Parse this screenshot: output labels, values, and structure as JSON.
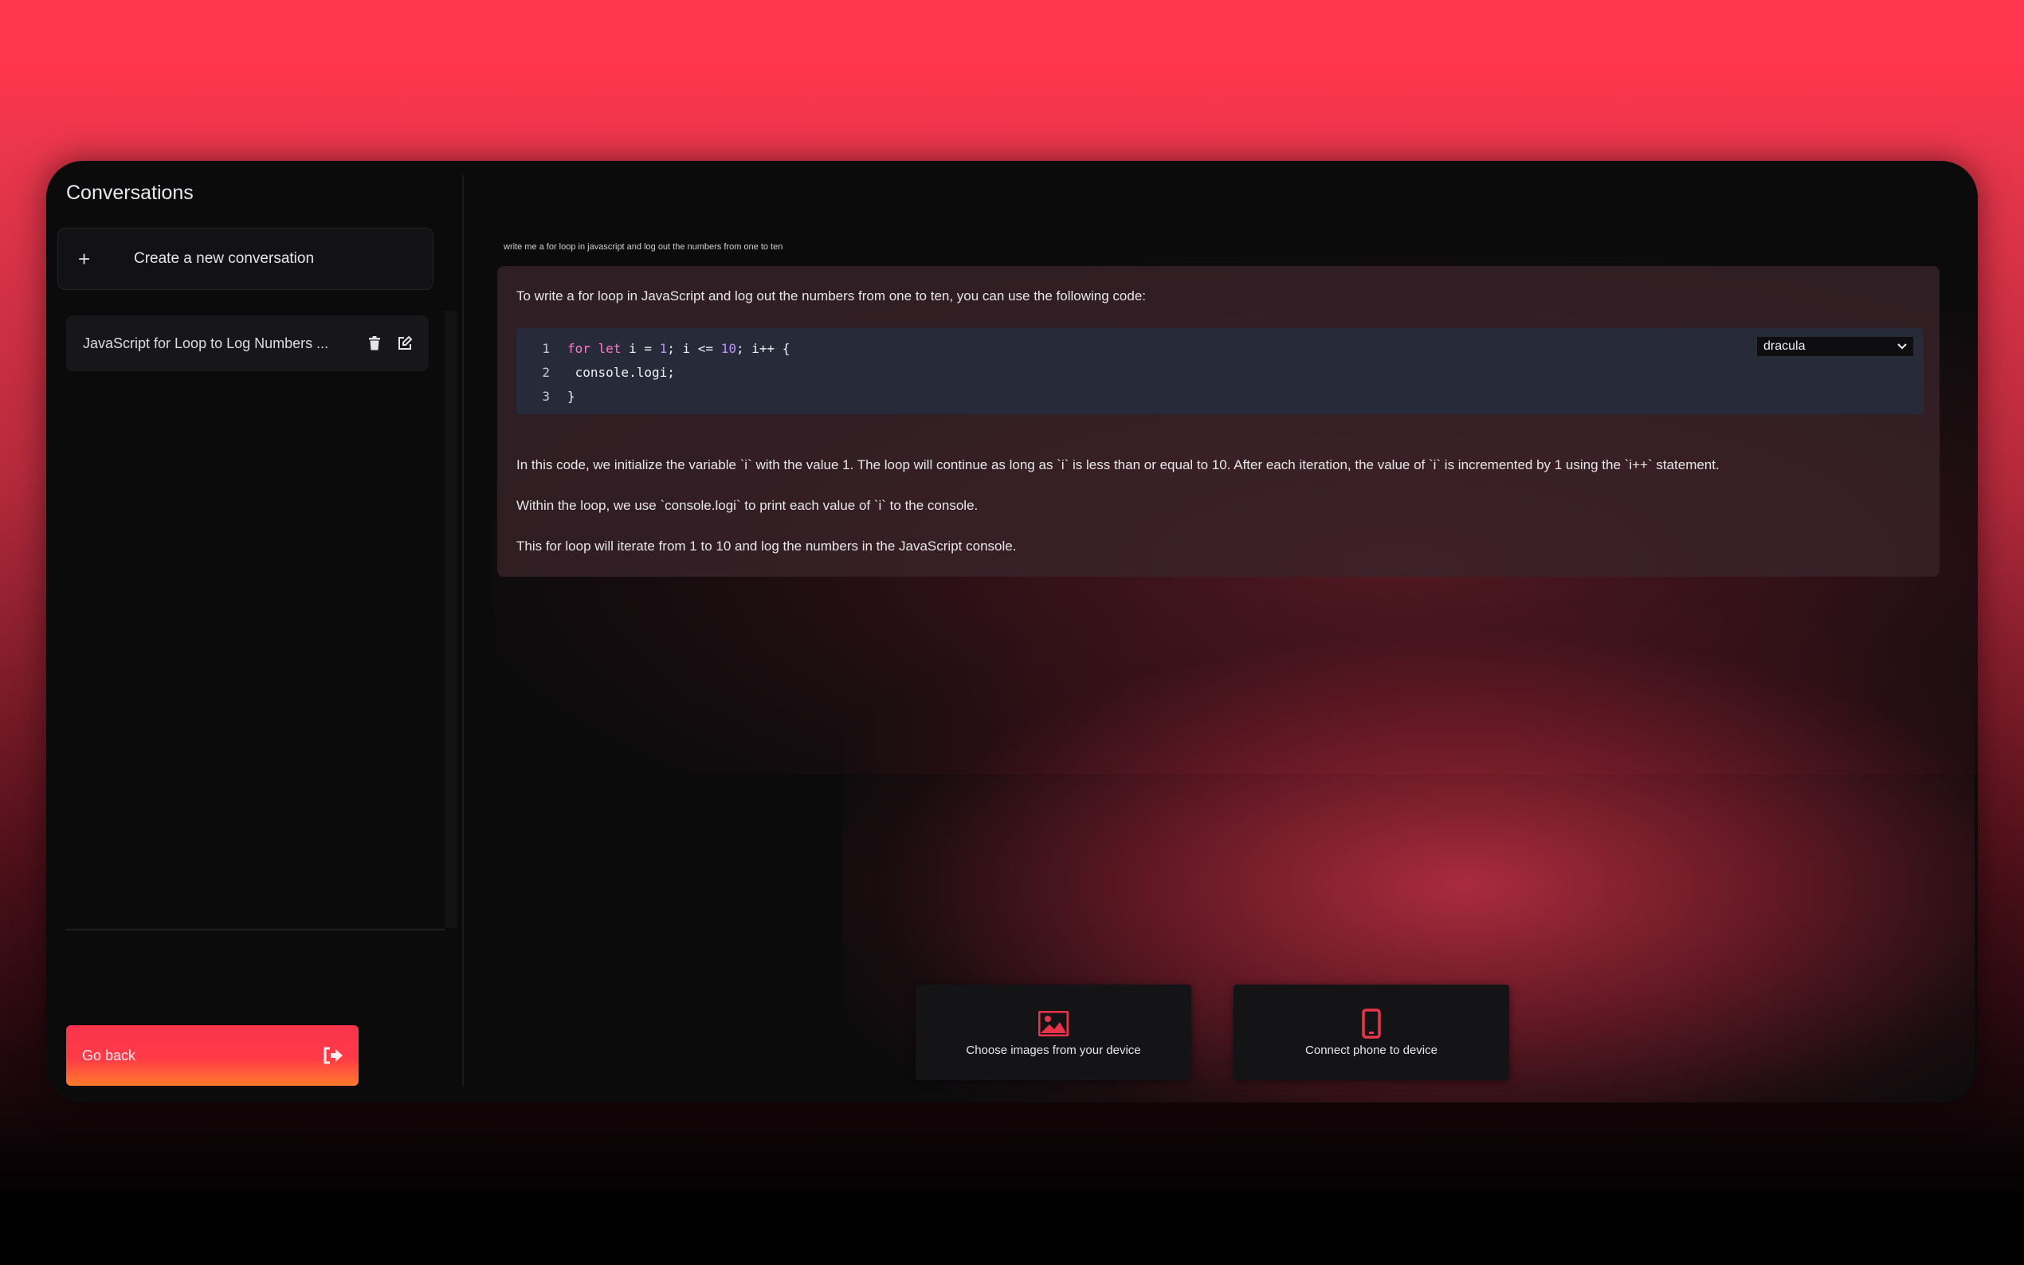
{
  "sidebar": {
    "title": "Conversations",
    "new_conversation_label": "Create a new conversation",
    "conversations": [
      {
        "title": "JavaScript for Loop to Log Numbers ..."
      }
    ],
    "go_back_label": "Go back"
  },
  "chat": {
    "prompt": "write me a for loop in javascript and log out the numbers from one to ten",
    "answer_intro": "To write a for loop in JavaScript and log out the numbers from one to ten, you can use the following code:",
    "code": {
      "theme": "dracula",
      "lines": [
        {
          "n": "1",
          "kw": "for let",
          "rest_a": " i = ",
          "num_a": "1",
          "rest_b": "; i <= ",
          "num_b": "10",
          "rest_c": "; i++ {"
        },
        {
          "n": "2",
          "text": " console.logi;"
        },
        {
          "n": "3",
          "text": "}"
        }
      ]
    },
    "paragraph_1": "In this code, we initialize the variable `i` with the value 1. The loop will continue as long as `i` is less than or equal to 10. After each iteration, the value of `i` is incremented by 1 using the `i++` statement.",
    "paragraph_2": "Within the loop, we use `console.logi` to print each value of `i` to the console.",
    "paragraph_3": "This for loop will iterate from 1 to 10 and log the numbers in the JavaScript console."
  },
  "actions": {
    "choose_images_label": "Choose images from your device",
    "connect_phone_label": "Connect phone to device"
  },
  "colors": {
    "accent": "#ff364e",
    "accent_gradient_end": "#ff7b2b",
    "icon_red": "#e8334a"
  }
}
